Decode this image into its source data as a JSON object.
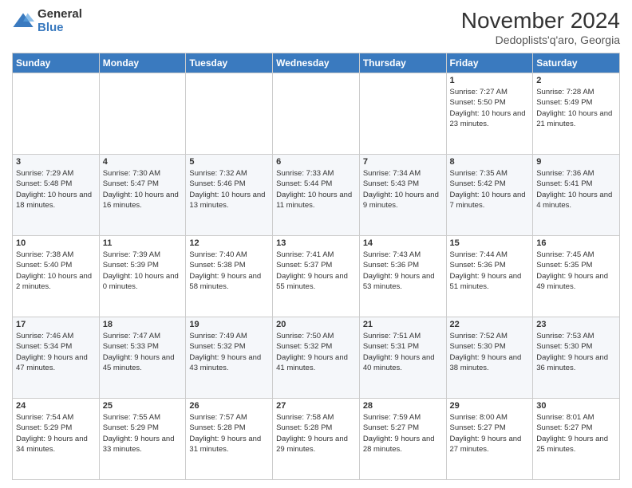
{
  "logo": {
    "general": "General",
    "blue": "Blue"
  },
  "header": {
    "month": "November 2024",
    "location": "Dedoplists'q'aro, Georgia"
  },
  "days_of_week": [
    "Sunday",
    "Monday",
    "Tuesday",
    "Wednesday",
    "Thursday",
    "Friday",
    "Saturday"
  ],
  "weeks": [
    [
      {
        "day": "",
        "info": ""
      },
      {
        "day": "",
        "info": ""
      },
      {
        "day": "",
        "info": ""
      },
      {
        "day": "",
        "info": ""
      },
      {
        "day": "",
        "info": ""
      },
      {
        "day": "1",
        "info": "Sunrise: 7:27 AM\nSunset: 5:50 PM\nDaylight: 10 hours and 23 minutes."
      },
      {
        "day": "2",
        "info": "Sunrise: 7:28 AM\nSunset: 5:49 PM\nDaylight: 10 hours and 21 minutes."
      }
    ],
    [
      {
        "day": "3",
        "info": "Sunrise: 7:29 AM\nSunset: 5:48 PM\nDaylight: 10 hours and 18 minutes."
      },
      {
        "day": "4",
        "info": "Sunrise: 7:30 AM\nSunset: 5:47 PM\nDaylight: 10 hours and 16 minutes."
      },
      {
        "day": "5",
        "info": "Sunrise: 7:32 AM\nSunset: 5:46 PM\nDaylight: 10 hours and 13 minutes."
      },
      {
        "day": "6",
        "info": "Sunrise: 7:33 AM\nSunset: 5:44 PM\nDaylight: 10 hours and 11 minutes."
      },
      {
        "day": "7",
        "info": "Sunrise: 7:34 AM\nSunset: 5:43 PM\nDaylight: 10 hours and 9 minutes."
      },
      {
        "day": "8",
        "info": "Sunrise: 7:35 AM\nSunset: 5:42 PM\nDaylight: 10 hours and 7 minutes."
      },
      {
        "day": "9",
        "info": "Sunrise: 7:36 AM\nSunset: 5:41 PM\nDaylight: 10 hours and 4 minutes."
      }
    ],
    [
      {
        "day": "10",
        "info": "Sunrise: 7:38 AM\nSunset: 5:40 PM\nDaylight: 10 hours and 2 minutes."
      },
      {
        "day": "11",
        "info": "Sunrise: 7:39 AM\nSunset: 5:39 PM\nDaylight: 10 hours and 0 minutes."
      },
      {
        "day": "12",
        "info": "Sunrise: 7:40 AM\nSunset: 5:38 PM\nDaylight: 9 hours and 58 minutes."
      },
      {
        "day": "13",
        "info": "Sunrise: 7:41 AM\nSunset: 5:37 PM\nDaylight: 9 hours and 55 minutes."
      },
      {
        "day": "14",
        "info": "Sunrise: 7:43 AM\nSunset: 5:36 PM\nDaylight: 9 hours and 53 minutes."
      },
      {
        "day": "15",
        "info": "Sunrise: 7:44 AM\nSunset: 5:36 PM\nDaylight: 9 hours and 51 minutes."
      },
      {
        "day": "16",
        "info": "Sunrise: 7:45 AM\nSunset: 5:35 PM\nDaylight: 9 hours and 49 minutes."
      }
    ],
    [
      {
        "day": "17",
        "info": "Sunrise: 7:46 AM\nSunset: 5:34 PM\nDaylight: 9 hours and 47 minutes."
      },
      {
        "day": "18",
        "info": "Sunrise: 7:47 AM\nSunset: 5:33 PM\nDaylight: 9 hours and 45 minutes."
      },
      {
        "day": "19",
        "info": "Sunrise: 7:49 AM\nSunset: 5:32 PM\nDaylight: 9 hours and 43 minutes."
      },
      {
        "day": "20",
        "info": "Sunrise: 7:50 AM\nSunset: 5:32 PM\nDaylight: 9 hours and 41 minutes."
      },
      {
        "day": "21",
        "info": "Sunrise: 7:51 AM\nSunset: 5:31 PM\nDaylight: 9 hours and 40 minutes."
      },
      {
        "day": "22",
        "info": "Sunrise: 7:52 AM\nSunset: 5:30 PM\nDaylight: 9 hours and 38 minutes."
      },
      {
        "day": "23",
        "info": "Sunrise: 7:53 AM\nSunset: 5:30 PM\nDaylight: 9 hours and 36 minutes."
      }
    ],
    [
      {
        "day": "24",
        "info": "Sunrise: 7:54 AM\nSunset: 5:29 PM\nDaylight: 9 hours and 34 minutes."
      },
      {
        "day": "25",
        "info": "Sunrise: 7:55 AM\nSunset: 5:29 PM\nDaylight: 9 hours and 33 minutes."
      },
      {
        "day": "26",
        "info": "Sunrise: 7:57 AM\nSunset: 5:28 PM\nDaylight: 9 hours and 31 minutes."
      },
      {
        "day": "27",
        "info": "Sunrise: 7:58 AM\nSunset: 5:28 PM\nDaylight: 9 hours and 29 minutes."
      },
      {
        "day": "28",
        "info": "Sunrise: 7:59 AM\nSunset: 5:27 PM\nDaylight: 9 hours and 28 minutes."
      },
      {
        "day": "29",
        "info": "Sunrise: 8:00 AM\nSunset: 5:27 PM\nDaylight: 9 hours and 27 minutes."
      },
      {
        "day": "30",
        "info": "Sunrise: 8:01 AM\nSunset: 5:27 PM\nDaylight: 9 hours and 25 minutes."
      }
    ]
  ]
}
